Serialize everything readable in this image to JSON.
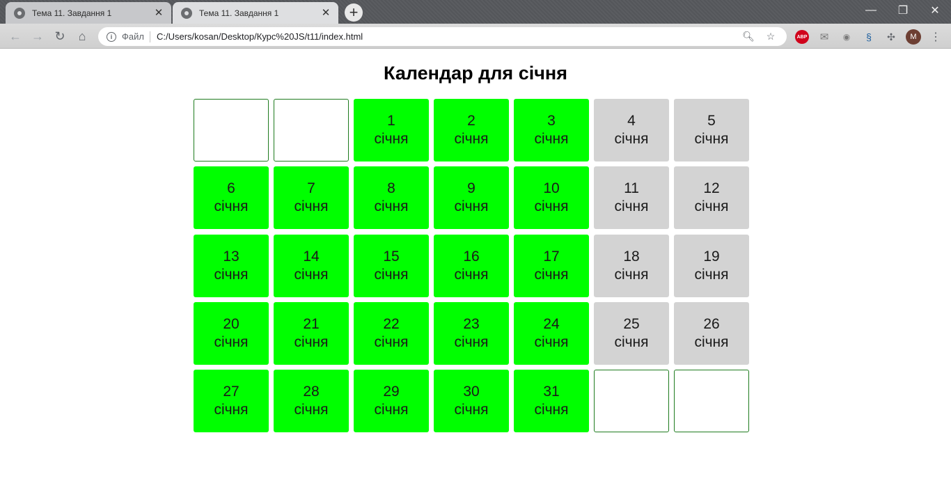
{
  "browser": {
    "tabs": [
      {
        "title": "Тема 11. Завдання 1",
        "active": false
      },
      {
        "title": "Тема 11. Завдання 1",
        "active": true
      }
    ],
    "address": {
      "scheme_label": "Файл",
      "url": "C:/Users/kosan/Desktop/Курс%20JS/t11/index.html"
    },
    "extensions": {
      "abp_label": "ABP",
      "avatar_letter": "M"
    }
  },
  "page": {
    "title": "Календар для січня",
    "month_word": "січня",
    "colors": {
      "workday": "#00ff00",
      "weekend": "#d3d3d3",
      "empty_border": "#1e7b1e"
    },
    "days": [
      {
        "type": "empty"
      },
      {
        "type": "empty"
      },
      {
        "day": "1",
        "type": "workday"
      },
      {
        "day": "2",
        "type": "workday"
      },
      {
        "day": "3",
        "type": "workday"
      },
      {
        "day": "4",
        "type": "weekend"
      },
      {
        "day": "5",
        "type": "weekend"
      },
      {
        "day": "6",
        "type": "workday"
      },
      {
        "day": "7",
        "type": "workday"
      },
      {
        "day": "8",
        "type": "workday"
      },
      {
        "day": "9",
        "type": "workday"
      },
      {
        "day": "10",
        "type": "workday"
      },
      {
        "day": "11",
        "type": "weekend"
      },
      {
        "day": "12",
        "type": "weekend"
      },
      {
        "day": "13",
        "type": "workday"
      },
      {
        "day": "14",
        "type": "workday"
      },
      {
        "day": "15",
        "type": "workday"
      },
      {
        "day": "16",
        "type": "workday"
      },
      {
        "day": "17",
        "type": "workday"
      },
      {
        "day": "18",
        "type": "weekend"
      },
      {
        "day": "19",
        "type": "weekend"
      },
      {
        "day": "20",
        "type": "workday"
      },
      {
        "day": "21",
        "type": "workday"
      },
      {
        "day": "22",
        "type": "workday"
      },
      {
        "day": "23",
        "type": "workday"
      },
      {
        "day": "24",
        "type": "workday"
      },
      {
        "day": "25",
        "type": "weekend"
      },
      {
        "day": "26",
        "type": "weekend"
      },
      {
        "day": "27",
        "type": "workday"
      },
      {
        "day": "28",
        "type": "workday"
      },
      {
        "day": "29",
        "type": "workday"
      },
      {
        "day": "30",
        "type": "workday"
      },
      {
        "day": "31",
        "type": "workday"
      },
      {
        "type": "empty"
      },
      {
        "type": "empty"
      }
    ]
  }
}
